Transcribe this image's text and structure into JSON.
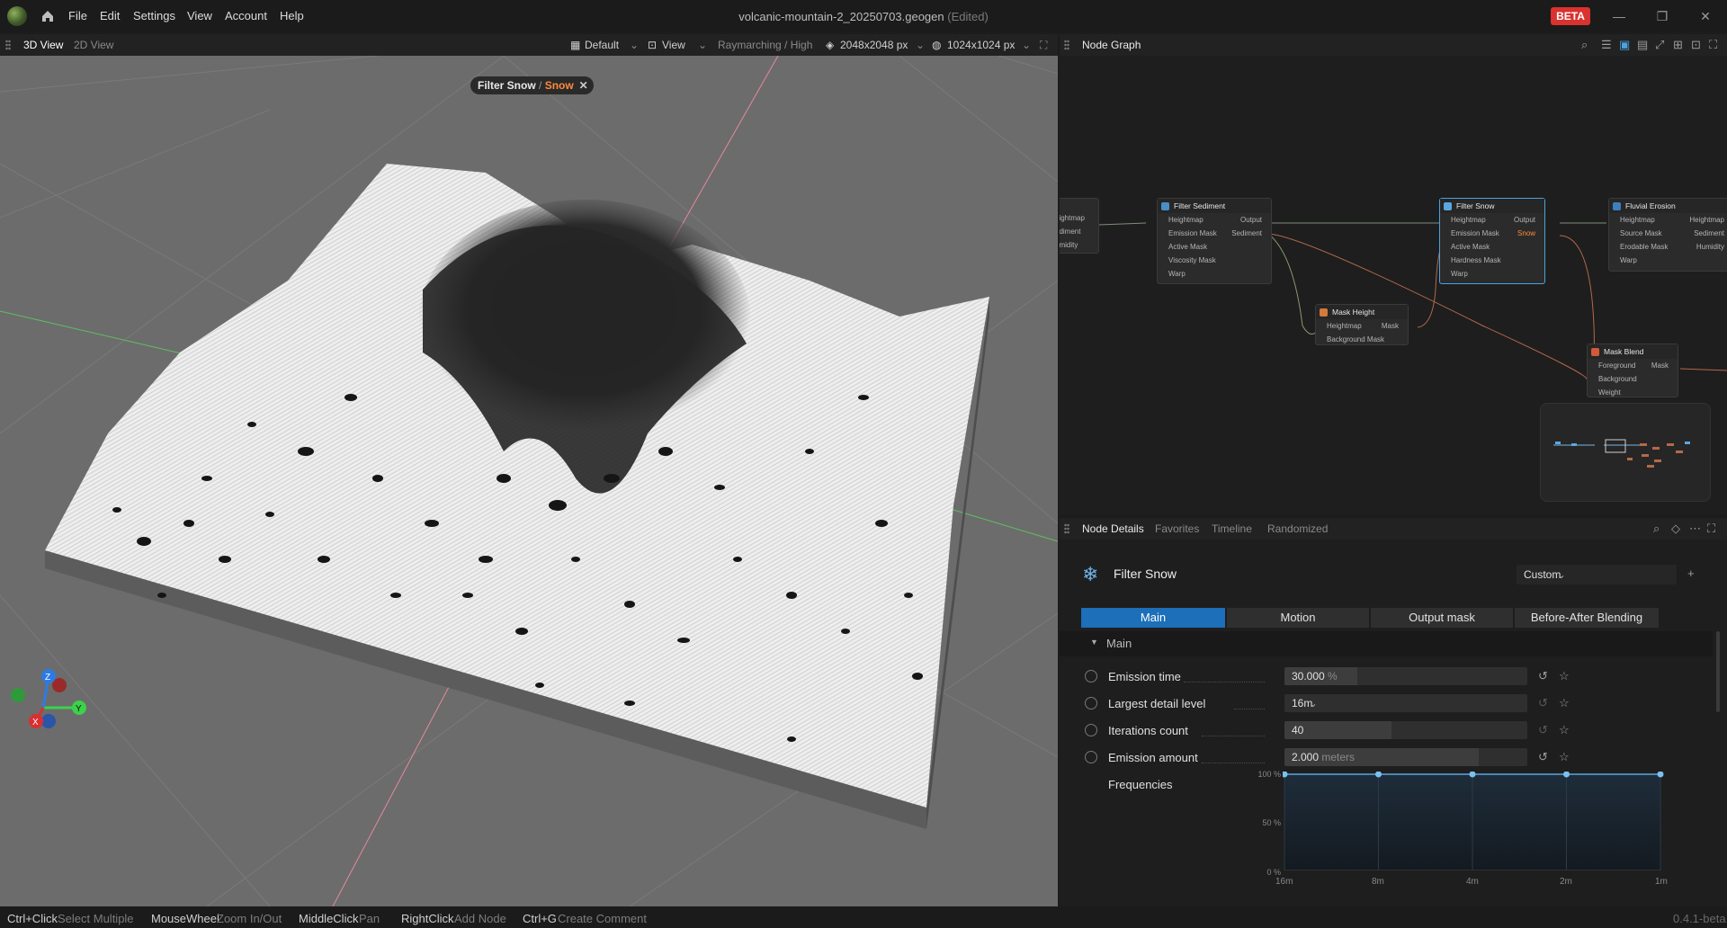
{
  "menu": [
    "File",
    "Edit",
    "Settings",
    "View",
    "Account",
    "Help"
  ],
  "window": {
    "title": "volcanic-mountain-2_20250703.geogen",
    "edited": "(Edited)",
    "beta": "BETA"
  },
  "viewport_toolbar": {
    "tabs": [
      "3D View",
      "2D View"
    ],
    "preset": "Default",
    "view": "View",
    "render": "Raymarching / High",
    "res1": "2048x2048 px",
    "res2": "1024x1024 px"
  },
  "viewport": {
    "pill_node": "Filter Snow",
    "pill_sep": " / ",
    "pill_output": "Snow"
  },
  "node_graph": {
    "title": "Node Graph",
    "nodes": {
      "left_partial": {
        "rows": [
          "eightmap",
          "ediment",
          "umidity"
        ]
      },
      "filter_sediment": {
        "title": "Filter Sediment",
        "inputs": [
          "Heightmap",
          "Emission Mask",
          "Active Mask",
          "Viscosity Mask",
          "Warp"
        ],
        "outputs": [
          "Output",
          "Sediment"
        ]
      },
      "filter_snow": {
        "title": "Filter Snow",
        "inputs": [
          "Heightmap",
          "Emission Mask",
          "Active Mask",
          "Hardness Mask",
          "Warp"
        ],
        "outputs": [
          "Output",
          "Snow"
        ]
      },
      "fluvial_erosion": {
        "title": "Fluvial Erosion",
        "inputs": [
          "Heightmap",
          "Source Mask",
          "Erodable Mask",
          "Warp"
        ],
        "outputs": [
          "Heightmap",
          "Sediment",
          "Humidity"
        ]
      },
      "mask_height": {
        "title": "Mask Height",
        "inputs": [
          "Heightmap",
          "Background Mask"
        ],
        "outputs": [
          "Mask"
        ]
      },
      "mask_blend": {
        "title": "Mask Blend",
        "inputs": [
          "Foreground",
          "Background",
          "Weight"
        ],
        "outputs": [
          "Mask"
        ]
      }
    }
  },
  "details_tabs": [
    "Node Details",
    "Favorites",
    "Timeline",
    "Randomized"
  ],
  "details": {
    "node_name": "Filter Snow",
    "preset": "Custom",
    "tabs": [
      "Main",
      "Motion",
      "Output mask",
      "Before-After Blending"
    ],
    "section": "Main",
    "props": [
      {
        "label": "Emission time",
        "value": "30.000",
        "unit": "%",
        "fill": 0.3
      },
      {
        "label": "Largest detail level",
        "value": "16m",
        "unit": "",
        "fill": 0
      },
      {
        "label": "Iterations count",
        "value": "40",
        "unit": "",
        "fill": 0.44
      },
      {
        "label": "Emission amount",
        "value": "2.000",
        "unit": "meters",
        "fill": 0.8
      }
    ],
    "frequencies": {
      "label": "Frequencies",
      "y_ticks": [
        "100 %",
        "50 %",
        "0 %"
      ],
      "x_ticks": [
        "16m",
        "8m",
        "4m",
        "2m",
        "1m"
      ],
      "values": [
        100,
        100,
        100,
        100,
        100
      ]
    }
  },
  "status": {
    "items": [
      {
        "key": "Ctrl+Click",
        "action": "Select Multiple"
      },
      {
        "key": "MouseWheel",
        "action": "Zoom In/Out"
      },
      {
        "key": "MiddleClick",
        "action": "Pan"
      },
      {
        "key": "RightClick",
        "action": "Add Node"
      },
      {
        "key": "Ctrl+G",
        "action": "Create Comment"
      }
    ],
    "version": "0.4.1-beta"
  },
  "colors": {
    "accent": "#1c6fb8",
    "beta": "#d9322f",
    "output_hl": "#ff8a3c",
    "selection": "#4aa3df"
  }
}
